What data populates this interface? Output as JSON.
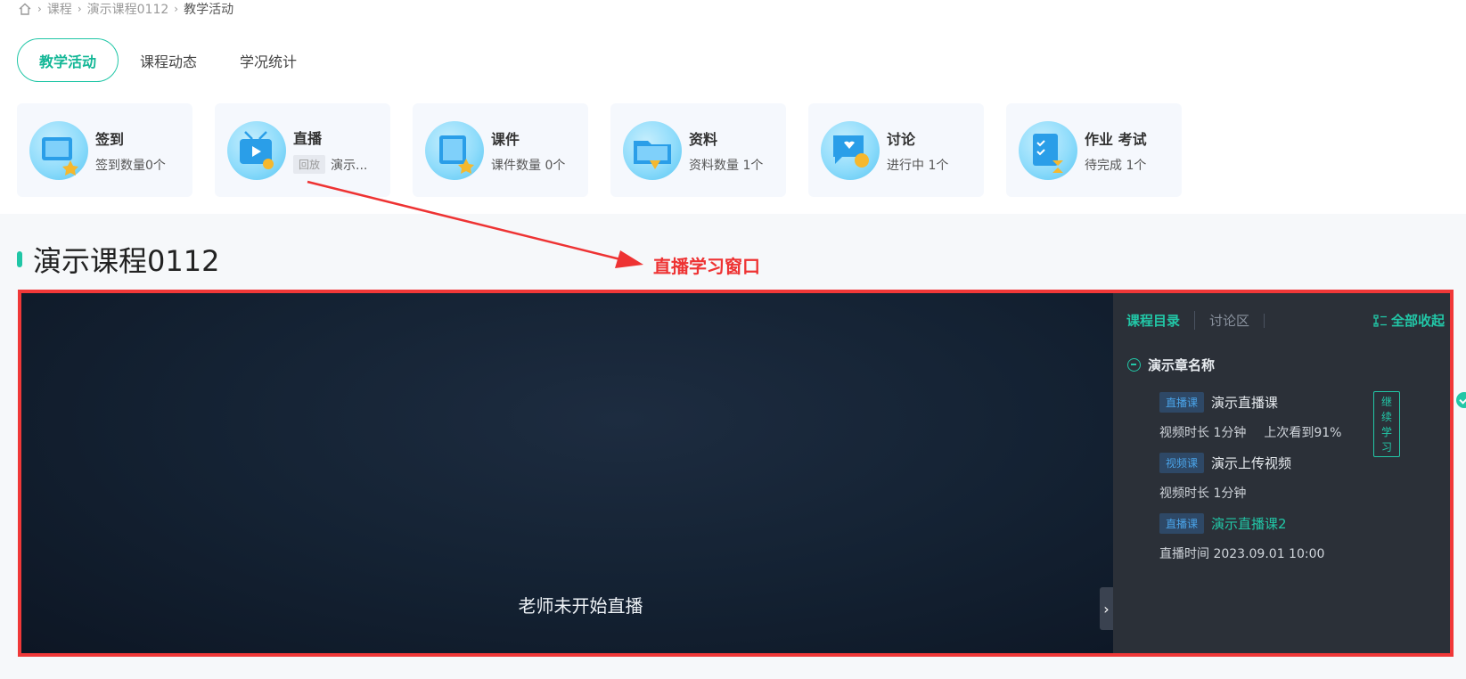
{
  "breadcrumb": {
    "items": [
      "课程",
      "演示课程0112"
    ],
    "current": "教学活动"
  },
  "tabs": [
    {
      "label": "教学活动",
      "active": true
    },
    {
      "label": "课程动态",
      "active": false
    },
    {
      "label": "学况统计",
      "active": false
    }
  ],
  "cards": [
    {
      "title": "签到",
      "sub": "签到数量0个",
      "icon": "checkin-icon"
    },
    {
      "title": "直播",
      "tag": "回放",
      "sub": "演示...",
      "icon": "live-tv-icon"
    },
    {
      "title": "课件",
      "sub": "课件数量 0个",
      "icon": "courseware-icon"
    },
    {
      "title": "资料",
      "sub": "资料数量 1个",
      "icon": "folder-icon"
    },
    {
      "title": "讨论",
      "sub": "进行中 1个",
      "icon": "chat-icon"
    },
    {
      "title": "作业 考试",
      "sub": "待完成 1个",
      "icon": "homework-icon"
    }
  ],
  "course": {
    "title": "演示课程0112"
  },
  "annotation": {
    "label": "直播学习窗口",
    "color": "#ee3333"
  },
  "player": {
    "message": "老师未开始直播",
    "side_tabs": [
      "课程目录",
      "讨论区"
    ],
    "collapse_all": "全部收起",
    "chapter": "演示章名称",
    "lessons": [
      {
        "tag": "直播课",
        "name": "演示直播课",
        "continue": "继续学习",
        "completed": true,
        "meta1": "视频时长  1分钟",
        "meta2": "上次看到91%"
      },
      {
        "tag": "视频课",
        "name": "演示上传视频",
        "meta1": "视频时长  1分钟"
      },
      {
        "tag": "直播课",
        "name": "演示直播课2",
        "highlight": true,
        "meta1": "直播时间  2023.09.01 10:00"
      }
    ]
  },
  "colors": {
    "accent": "#20c6a6",
    "annotation": "#f03838",
    "panel_bg": "#2b3038"
  }
}
